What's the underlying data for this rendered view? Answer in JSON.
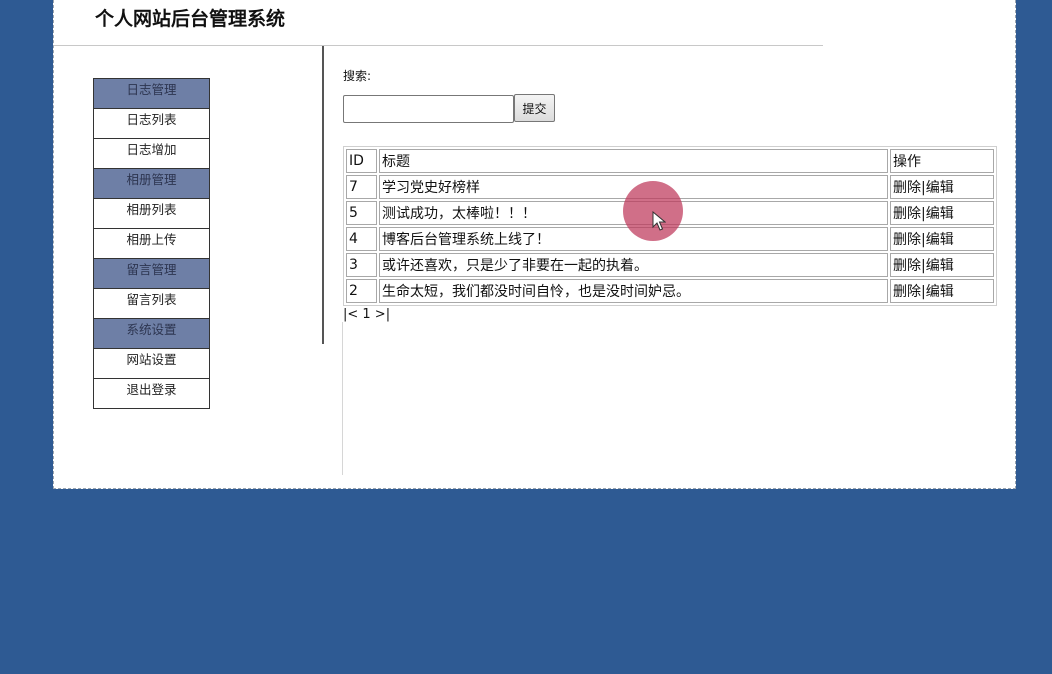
{
  "header": {
    "site_title": "个人网站后台管理系统"
  },
  "sidebar": {
    "menu": [
      {
        "label": "日志管理",
        "type": "group"
      },
      {
        "label": "日志列表",
        "type": "item"
      },
      {
        "label": "日志增加",
        "type": "item"
      },
      {
        "label": "相册管理",
        "type": "group"
      },
      {
        "label": "相册列表",
        "type": "item"
      },
      {
        "label": "相册上传",
        "type": "item"
      },
      {
        "label": "留言管理",
        "type": "group"
      },
      {
        "label": "留言列表",
        "type": "item"
      },
      {
        "label": "系统设置",
        "type": "group"
      },
      {
        "label": "网站设置",
        "type": "item"
      },
      {
        "label": "退出登录",
        "type": "item"
      }
    ]
  },
  "search": {
    "label": "搜索:",
    "value": "",
    "submit_label": "提交"
  },
  "table": {
    "headers": {
      "id": "ID",
      "title": "标题",
      "ops": "操作"
    },
    "op_delete": "删除",
    "op_separator": "|",
    "op_edit": "编辑",
    "rows": [
      {
        "id": "7",
        "title": "学习党史好榜样"
      },
      {
        "id": "5",
        "title": "测试成功，太棒啦！！！"
      },
      {
        "id": "4",
        "title": "博客后台管理系统上线了！"
      },
      {
        "id": "3",
        "title": "或许还喜欢，只是少了非要在一起的执着。"
      },
      {
        "id": "2",
        "title": "生命太短，我们都没时间自怜，也是没时间妒忌。"
      }
    ]
  },
  "pagination": {
    "text": "|< 1 >|"
  },
  "colors": {
    "page_background": "#2e5a93",
    "menu_group_background": "#6e7fa6",
    "cursor_highlight": "#be375a"
  }
}
